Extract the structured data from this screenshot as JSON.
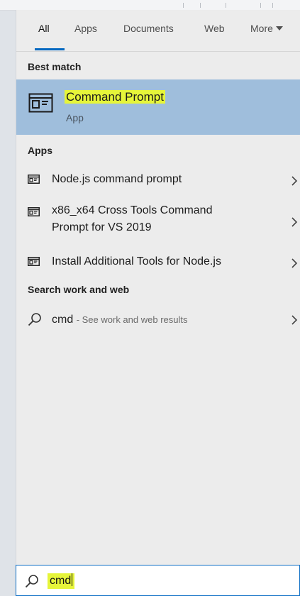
{
  "tabs": [
    {
      "label": "All"
    },
    {
      "label": "Apps"
    },
    {
      "label": "Documents"
    },
    {
      "label": "Web"
    },
    {
      "label": "More"
    }
  ],
  "sections": {
    "best_match": "Best match",
    "apps": "Apps",
    "search_web": "Search work and web"
  },
  "best_match": {
    "title": "Command Prompt",
    "subtitle": "App",
    "icon": "console-window-icon"
  },
  "apps": [
    {
      "label": "Node.js command prompt",
      "icon": "console-window-icon"
    },
    {
      "label_line1": "x86_x64 Cross Tools Command",
      "label_line2": "Prompt for VS 2019",
      "icon": "console-window-icon"
    },
    {
      "label": "Install Additional Tools for Node.js",
      "icon": "console-window-icon"
    }
  ],
  "web": {
    "query": "cmd",
    "hint": "- See work and web results",
    "icon": "search-icon"
  },
  "search": {
    "value": "cmd",
    "icon": "search-icon"
  },
  "colors": {
    "accent": "#0067c0",
    "selected_bg": "#9fbedc",
    "highlight": "#e6f53a"
  }
}
